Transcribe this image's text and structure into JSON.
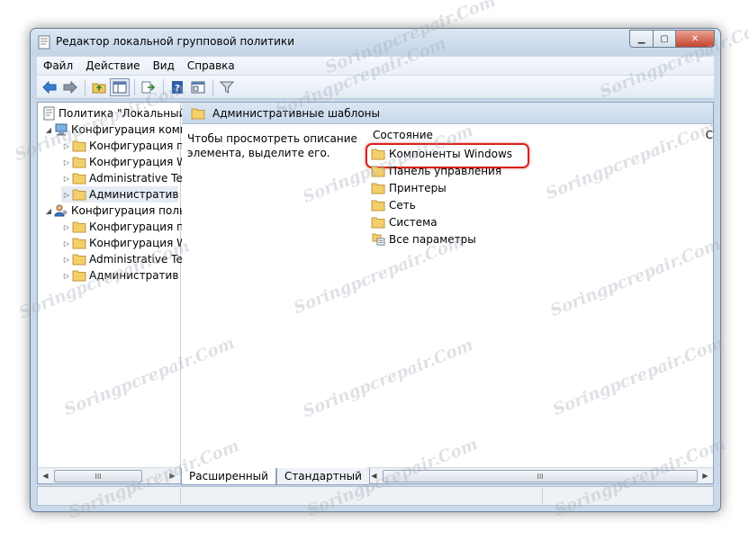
{
  "window": {
    "title": "Редактор локальной групповой политики"
  },
  "menu": [
    "Файл",
    "Действие",
    "Вид",
    "Справка"
  ],
  "tree": [
    {
      "label": "Политика \"Локальный",
      "level": 0,
      "icon": "computer-policy-icon"
    },
    {
      "label": "Конфигурация комп",
      "level": 1,
      "icon": "computer-icon",
      "expanded": true
    },
    {
      "label": "Конфигурация п",
      "level": 2,
      "icon": "folder-icon"
    },
    {
      "label": "Конфигурация W",
      "level": 2,
      "icon": "folder-icon"
    },
    {
      "label": "Administrative Te",
      "level": 2,
      "icon": "folder-icon"
    },
    {
      "label": "Административ",
      "level": 2,
      "icon": "folder-icon",
      "selected": true
    },
    {
      "label": "Конфигурация поль",
      "level": 1,
      "icon": "user-icon",
      "expanded": true
    },
    {
      "label": "Конфигурация п",
      "level": 2,
      "icon": "folder-icon"
    },
    {
      "label": "Конфигурация W",
      "level": 2,
      "icon": "folder-icon"
    },
    {
      "label": "Administrative Te",
      "level": 2,
      "icon": "folder-icon"
    },
    {
      "label": "Административ",
      "level": 2,
      "icon": "folder-icon"
    }
  ],
  "pane": {
    "header": "Административные шаблоны",
    "description": "Чтобы просмотреть описание элемента, выделите его.",
    "column_state": "Состояние",
    "column_extra": "С"
  },
  "items": [
    {
      "label": "Компоненты Windows",
      "icon": "folder-icon",
      "highlighted": true
    },
    {
      "label": "Панель управления",
      "icon": "folder-icon"
    },
    {
      "label": "Принтеры",
      "icon": "folder-icon"
    },
    {
      "label": "Сеть",
      "icon": "folder-icon"
    },
    {
      "label": "Система",
      "icon": "folder-icon"
    },
    {
      "label": "Все параметры",
      "icon": "settings-list-icon"
    }
  ],
  "tabs": [
    "Расширенный",
    "Стандартный"
  ],
  "scroll_thumb": "III",
  "watermark": "Soringpcrepair.Com",
  "colors": {
    "highlight": "#d9201c",
    "folder": "#f3cf6c",
    "accent": "#c7d8ec"
  }
}
